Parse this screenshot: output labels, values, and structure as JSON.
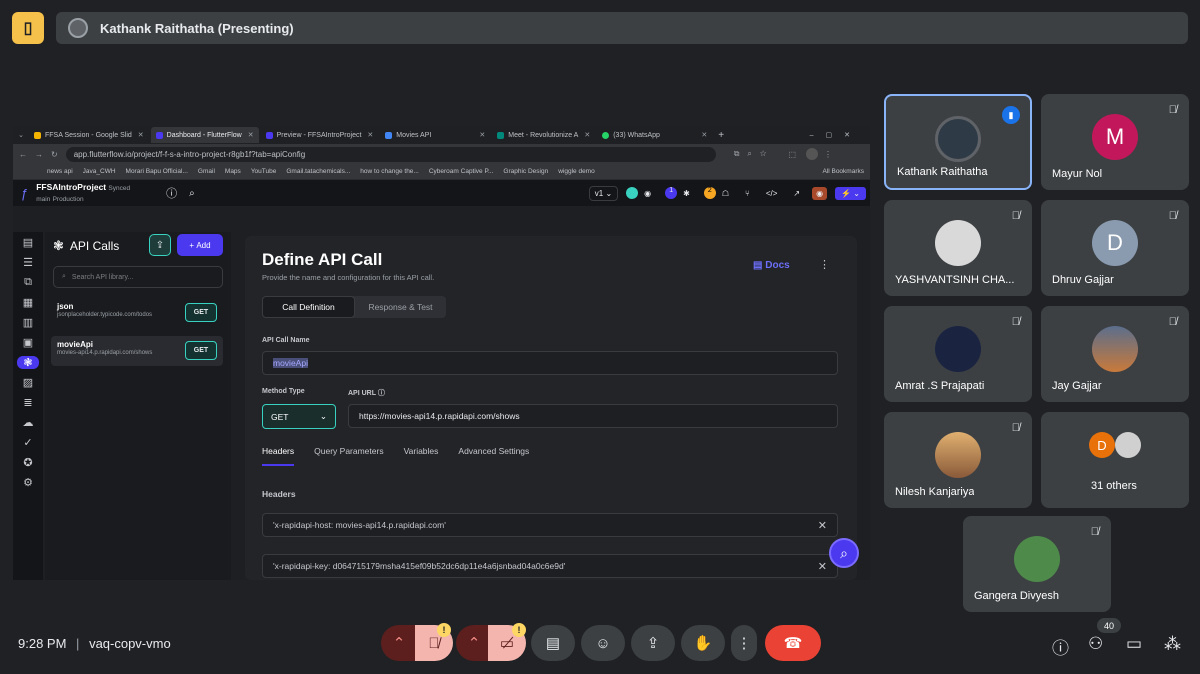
{
  "meeting": {
    "presenter_bar": "Kathank Raithatha (Presenting)",
    "time": "9:28 PM",
    "separator": "|",
    "code": "vaq-copv-vmo",
    "people_count": "40"
  },
  "browser": {
    "tabs": [
      {
        "label": "FFSA Session - Google Slid",
        "color": "#f4b400"
      },
      {
        "label": "Dashboard - FlutterFlow",
        "color": "#4b39ef",
        "active": true
      },
      {
        "label": "Preview - FFSAIntroProject",
        "color": "#4b39ef"
      },
      {
        "label": "Movies API",
        "color": "#4285f4"
      },
      {
        "label": "Meet - Revolutionize A",
        "color": "#00897b"
      },
      {
        "label": "(33) WhatsApp",
        "color": "#25d366"
      }
    ],
    "url": "app.flutterflow.io/project/f-f-s-a-intro-project-r8gb1f?tab=apiConfig",
    "bookmarks": [
      "news api",
      "Java_CWH",
      "Morari Bapu Official...",
      "Gmail",
      "Maps",
      "YouTube",
      "Gmail.tatachemicals...",
      "how to change the...",
      "Cyberoam Captive P...",
      "Graphic Design",
      "wiggle demo",
      "All Bookmarks"
    ]
  },
  "ff": {
    "project": "FFSAIntroProject",
    "synced": "Synced",
    "branch": "main",
    "env": "Production",
    "version": "v1",
    "panel_title": "API Calls",
    "add_label": "Add",
    "search_placeholder": "Search API library...",
    "apis": [
      {
        "name": "json",
        "url": "jsonplaceholder.typicode.com/todos",
        "method": "GET"
      },
      {
        "name": "movieApi",
        "url": "movies-api14.p.rapidapi.com/shows",
        "method": "GET"
      }
    ],
    "define": {
      "title": "Define API Call",
      "subtitle": "Provide the name and configuration for this API call.",
      "docs": "Docs",
      "seg_def": "Call Definition",
      "seg_resp": "Response & Test",
      "name_label": "API Call Name",
      "name_value": "movieApi",
      "method_label": "Method Type",
      "method_value": "GET",
      "url_label": "API URL",
      "url_value": "https://movies-api14.p.rapidapi.com/shows",
      "subtabs": [
        "Headers",
        "Query Parameters",
        "Variables",
        "Advanced Settings"
      ],
      "headers_label": "Headers",
      "headers": [
        "'x-rapidapi-host: movies-api14.p.rapidapi.com'",
        "'x-rapidapi-key: d064715179msha415ef09b52dc6dp11e4a6jsnbad04a0c6e9d'"
      ]
    }
  },
  "participants": [
    {
      "name": "Kathank Raithatha",
      "initial": "",
      "color": "#2e3a45"
    },
    {
      "name": "Mayur Nol",
      "initial": "M",
      "color": "#c2185b"
    },
    {
      "name": "YASHVANTSINH CHA...",
      "initial": "",
      "color": "#d9d9d9"
    },
    {
      "name": "Dhruv Gajjar",
      "initial": "D",
      "color": "#8a9bb0"
    },
    {
      "name": "Amrat .S Prajapati",
      "initial": "",
      "color": "#1a2440"
    },
    {
      "name": "Jay Gajjar",
      "initial": "",
      "color": "#c97a3b"
    },
    {
      "name": "Nilesh Kanjariya",
      "initial": "",
      "color": "#8a5a3a"
    },
    {
      "name": "31 others",
      "initial": "D",
      "color": "#e8710a"
    },
    {
      "name": "Gangera Divyesh",
      "initial": "",
      "color": "#4e8a4a"
    }
  ]
}
